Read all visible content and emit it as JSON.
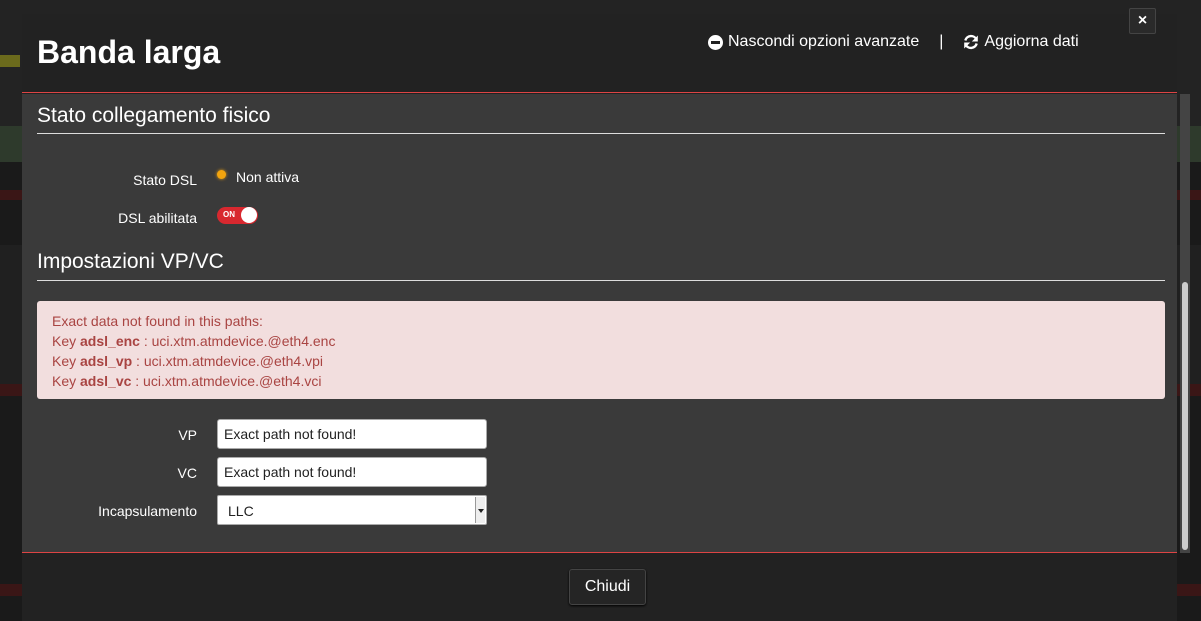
{
  "modal": {
    "title": "Banda larga",
    "hide_advanced_label": "Nascondi opzioni avanzate",
    "separator": "|",
    "refresh_label": "Aggiorna dati",
    "close_x": "×"
  },
  "physical_link": {
    "title": "Stato collegamento fisico",
    "dsl_status_label": "Stato DSL",
    "dsl_status_value": "Non attiva",
    "dsl_enabled_label": "DSL abilitata",
    "dsl_enabled_toggle": "ON"
  },
  "vpvc": {
    "title": "Impostazioni VP/VC",
    "alert": {
      "heading": "Exact data not found in this paths:",
      "lines": [
        {
          "prefix": "Key ",
          "key": "adsl_enc",
          "path": " : uci.xtm.atmdevice.@eth4.enc"
        },
        {
          "prefix": "Key ",
          "key": "adsl_vp",
          "path": " : uci.xtm.atmdevice.@eth4.vpi"
        },
        {
          "prefix": "Key ",
          "key": "adsl_vc",
          "path": " : uci.xtm.atmdevice.@eth4.vci"
        }
      ]
    },
    "vp_label": "VP",
    "vp_value": "Exact path not found!",
    "vc_label": "VC",
    "vc_value": "Exact path not found!",
    "encap_label": "Incapsulamento",
    "encap_value": "LLC"
  },
  "footer": {
    "close_label": "Chiudi"
  },
  "colors": {
    "accent_red": "#d8282f",
    "status_orange": "#f2a40e",
    "alert_bg": "#f2dede",
    "alert_text": "#a94442"
  }
}
